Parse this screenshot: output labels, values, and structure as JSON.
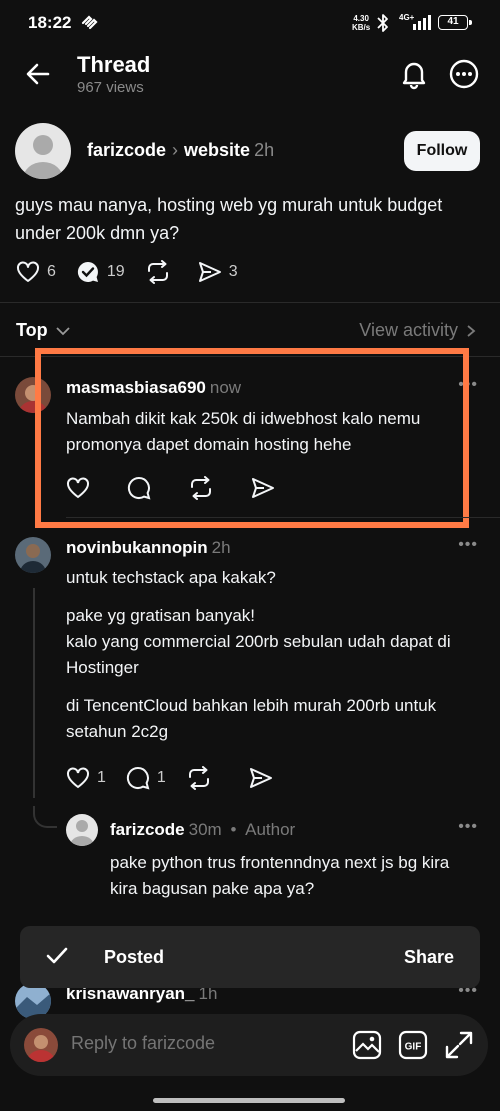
{
  "status_bar": {
    "time": "18:22",
    "speed_top": "4.30",
    "speed_bottom": "KB/s",
    "net": "4G+",
    "battery": "41"
  },
  "header": {
    "title": "Thread",
    "views": "967 views"
  },
  "post": {
    "author": "farizcode",
    "community": "website",
    "time": "2h",
    "follow_label": "Follow",
    "body": "guys mau nanya, hosting web yg murah untuk budget under 200k dmn ya?",
    "likes": "6",
    "comments": "19",
    "shares": "3"
  },
  "sort": {
    "label": "Top",
    "activity": "View activity"
  },
  "replies": [
    {
      "user": "masmasbiasa690",
      "time": "now",
      "text": "Nambah dikit kak 250k di idwebhost kalo nemu promonya dapet domain hosting hehe"
    },
    {
      "user": "novinbukannopin",
      "time": "2h",
      "paragraphs": [
        "untuk techstack apa kakak?",
        "pake yg gratisan banyak!\nkalo yang commercial 200rb sebulan udah dapat di Hostinger",
        "di TencentCloud bahkan lebih murah 200rb untuk setahun 2c2g"
      ],
      "likes": "1",
      "comments": "1"
    },
    {
      "user": "farizcode",
      "time": "30m",
      "role": "Author",
      "text": "pake python trus frontenndnya next js bg kira kira bagusan pake apa ya?"
    },
    {
      "user": "krisnawanryan_",
      "time": "1h"
    }
  ],
  "toast": {
    "status": "Posted",
    "action": "Share"
  },
  "composer": {
    "placeholder": "Reply to farizcode"
  },
  "colors": {
    "background": "#101010",
    "highlight": "#ff7a45",
    "muted": "#7a7a7a",
    "toast": "#262626"
  }
}
